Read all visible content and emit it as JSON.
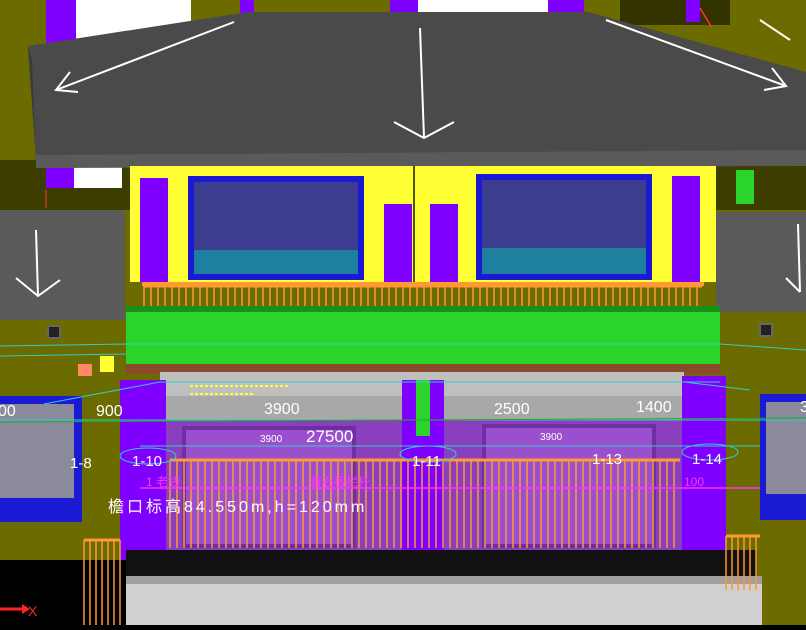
{
  "viewport": {
    "dims": [
      {
        "text": "00",
        "color": "#ffffff"
      },
      {
        "text": "900",
        "color": "#ffffff"
      },
      {
        "text": "3900",
        "color": "#ffffff"
      },
      {
        "text": "2500",
        "color": "#ffffff"
      },
      {
        "text": "1400",
        "color": "#ffffff"
      },
      {
        "text": "3",
        "color": "#ffffff"
      },
      {
        "text": "27500",
        "color": "#ffffff"
      },
      {
        "text": "3900",
        "color": "#ffffff"
      },
      {
        "text": "3900",
        "color": "#ffffff"
      }
    ],
    "grid_labels": [
      {
        "text": "1-8"
      },
      {
        "text": "1-10"
      },
      {
        "text": "1-11"
      },
      {
        "text": "1-13"
      },
      {
        "text": "1-14"
      }
    ],
    "annotations": {
      "elevation": "檐口标高84.550m,h=120mm",
      "magenta_left": "1 老钱",
      "magenta_mid": "青石板栏杆",
      "magenta_right": "100"
    },
    "axis": {
      "label": "X"
    },
    "colors": {
      "roof": "#4a4a4a",
      "yellow": "#ffff33",
      "purple": "#8000ff",
      "green": "#2ad42a",
      "olive": "#6b6b00",
      "window_blue": "#3d3d8f",
      "orange": "#ff9933",
      "cyan": "#33cccc"
    }
  }
}
